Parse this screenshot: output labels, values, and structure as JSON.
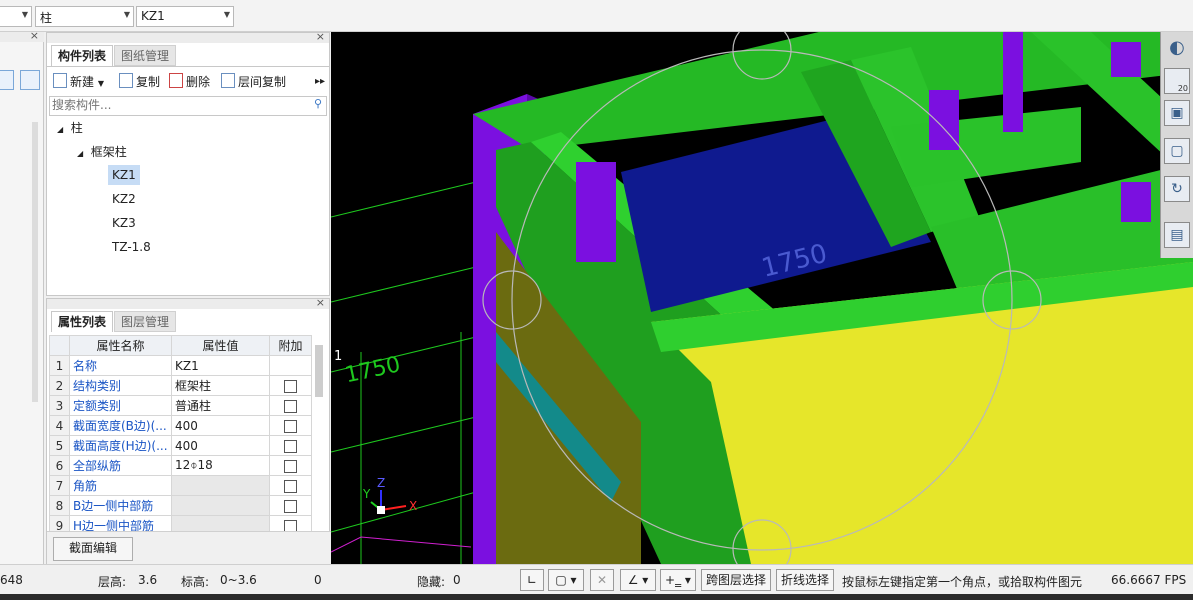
{
  "toolbar": {
    "floor_combo": "",
    "type_combo": "柱",
    "component_combo": "KZ1"
  },
  "component_panel": {
    "tabs": [
      "构件列表",
      "图纸管理"
    ],
    "actions": {
      "new": "新建",
      "copy": "复制",
      "delete": "删除",
      "floor_copy": "层间复制"
    },
    "search_placeholder": "搜索构件...",
    "tree": {
      "root": "柱",
      "group": "框架柱",
      "items": [
        "KZ1",
        "KZ2",
        "KZ3",
        "TZ-1.8"
      ],
      "selected": "KZ1"
    }
  },
  "property_panel": {
    "tabs": [
      "属性列表",
      "图层管理"
    ],
    "headers": [
      "属性名称",
      "属性值",
      "附加"
    ],
    "rows": [
      {
        "num": "1",
        "name": "名称",
        "value": "KZ1",
        "extra": false,
        "has_checkbox": false
      },
      {
        "num": "2",
        "name": "结构类别",
        "value": "框架柱",
        "extra": false,
        "has_checkbox": true
      },
      {
        "num": "3",
        "name": "定额类别",
        "value": "普通柱",
        "extra": false,
        "has_checkbox": true
      },
      {
        "num": "4",
        "name": "截面宽度(B边)(...",
        "value": "400",
        "extra": false,
        "has_checkbox": true
      },
      {
        "num": "5",
        "name": "截面高度(H边)(...",
        "value": "400",
        "extra": false,
        "has_checkbox": true
      },
      {
        "num": "6",
        "name": "全部纵筋",
        "value": "12⌽18",
        "extra": false,
        "has_checkbox": true
      },
      {
        "num": "7",
        "name": "角筋",
        "value": "",
        "extra": false,
        "has_checkbox": true
      },
      {
        "num": "8",
        "name": "B边一侧中部筋",
        "value": "",
        "extra": false,
        "has_checkbox": true
      },
      {
        "num": "9",
        "name": "H边一侧中部筋",
        "value": "",
        "extra": false,
        "has_checkbox": true
      }
    ],
    "section_edit_button": "截面编辑"
  },
  "canvas": {
    "dimension_labels": [
      "1750",
      "1750"
    ],
    "axis_marker": "1",
    "axes": {
      "x": "X",
      "y": "Y",
      "z": "Z"
    }
  },
  "right_toolbar": {
    "zoom_label": "20"
  },
  "status": {
    "left_value": "648",
    "floor_height_label": "层高:",
    "floor_height_value": "3.6",
    "elevation_label": "标高:",
    "elevation_value": "0~3.6",
    "zero_value": "0",
    "hidden_label": "隐藏:",
    "hidden_value": "0",
    "cross_floor_select": "跨图层选择",
    "polyline_select": "折线选择",
    "hint": "按鼠标左键指定第一个角点，或拾取构件图元",
    "fps": "66.6667 FPS"
  }
}
